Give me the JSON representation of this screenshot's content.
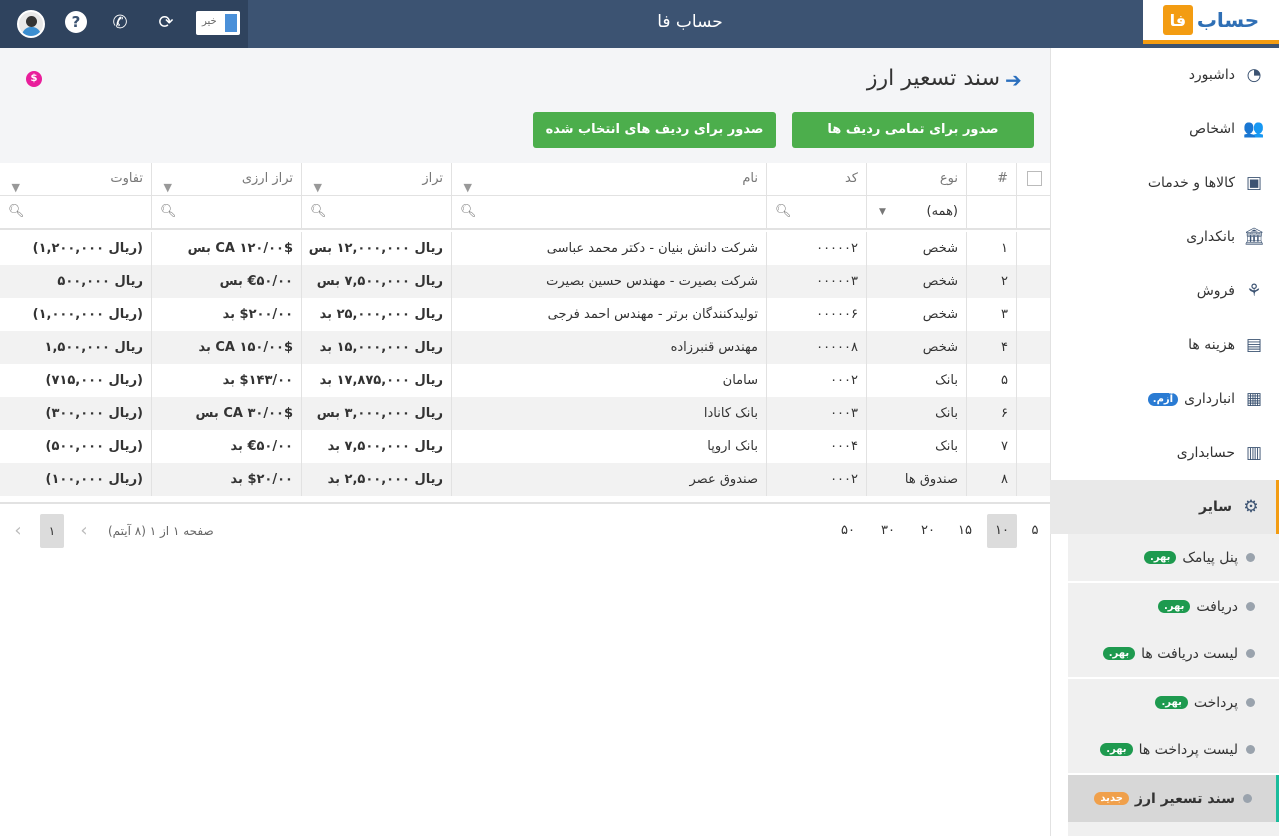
{
  "header": {
    "app_title": "حساب فا",
    "logo_text": "حساب",
    "logo_mark": "فا",
    "toggle_label": "خیر",
    "icons": [
      "user-avatar",
      "help-icon",
      "phone-icon",
      "refresh-icon",
      "toggle-switch"
    ]
  },
  "sidebar": {
    "items": [
      {
        "label": "داشبورد",
        "icon": "dashboard-icon"
      },
      {
        "label": "اشخاص",
        "icon": "people-icon"
      },
      {
        "label": "کالاها و خدمات",
        "icon": "box-icon"
      },
      {
        "label": "بانکداری",
        "icon": "bank-icon"
      },
      {
        "label": "فروش",
        "icon": "sales-icon"
      },
      {
        "label": "هزینه ها",
        "icon": "wallet-icon"
      },
      {
        "label": "انبارداری",
        "icon": "warehouse-icon",
        "badge": "آزم."
      },
      {
        "label": "حسابداری",
        "icon": "accounting-icon"
      },
      {
        "label": "سایر",
        "icon": "other-icon"
      }
    ],
    "sub_items": [
      {
        "label": "پنل پیامک",
        "badge": "بهر."
      },
      {
        "label": "دریافت",
        "badge": "بهر."
      },
      {
        "label": "لیست دریافت ها",
        "badge": "بهر."
      },
      {
        "label": "پرداخت",
        "badge": "بهر."
      },
      {
        "label": "لیست پرداخت ها",
        "badge": "بهر."
      },
      {
        "label": "سند تسعیر ارز",
        "badge": "جدید"
      }
    ]
  },
  "page": {
    "title": "سند تسعیر ارز",
    "btn_all": "صدور برای تمامی ردیف ها",
    "btn_selected": "صدور برای ردیف های انتخاب شده"
  },
  "grid": {
    "columns": [
      "#",
      "نوع",
      "کد",
      "نام",
      "تراز",
      "تراز ارزی",
      "تفاوت"
    ],
    "type_filter": "(همه)",
    "rows": [
      {
        "n": "۱",
        "type": "شخص",
        "code": "۰۰۰۰۰۲",
        "name": "شرکت دانش بنیان - دکتر محمد عباسی",
        "bal": "ریال ۱۲,۰۰۰,۰۰۰ بس",
        "fx": "$CA ۱۲۰/۰۰ بس",
        "diff": "(ریال ۱,۲۰۰,۰۰۰)",
        "bal_c": "blue",
        "fx_c": "blue",
        "diff_c": "red"
      },
      {
        "n": "۲",
        "type": "شخص",
        "code": "۰۰۰۰۰۳",
        "name": "شرکت بصیرت - مهندس حسین بصیرت",
        "bal": "ریال ۷,۵۰۰,۰۰۰ بس",
        "fx": "€۵۰/۰۰ بس",
        "diff": "ریال ۵۰۰,۰۰۰",
        "bal_c": "blue",
        "fx_c": "blue",
        "diff_c": "green"
      },
      {
        "n": "۳",
        "type": "شخص",
        "code": "۰۰۰۰۰۶",
        "name": "تولیدکنندگان برتر - مهندس احمد فرجی",
        "bal": "ریال ۲۵,۰۰۰,۰۰۰ بد",
        "fx": "$۲۰۰/۰۰ بد",
        "diff": "(ریال ۱,۰۰۰,۰۰۰)",
        "bal_c": "green",
        "fx_c": "green",
        "diff_c": "red"
      },
      {
        "n": "۴",
        "type": "شخص",
        "code": "۰۰۰۰۰۸",
        "name": "مهندس قنبرزاده",
        "bal": "ریال ۱۵,۰۰۰,۰۰۰ بد",
        "fx": "$CA ۱۵۰/۰۰ بد",
        "diff": "ریال ۱,۵۰۰,۰۰۰",
        "bal_c": "green",
        "fx_c": "green",
        "diff_c": "green"
      },
      {
        "n": "۵",
        "type": "بانک",
        "code": "۰۰۰۲",
        "name": "سامان",
        "bal": "ریال ۱۷,۸۷۵,۰۰۰ بد",
        "fx": "$۱۴۳/۰۰ بد",
        "diff": "(ریال ۷۱۵,۰۰۰)",
        "bal_c": "green",
        "fx_c": "green",
        "diff_c": "red"
      },
      {
        "n": "۶",
        "type": "بانک",
        "code": "۰۰۰۳",
        "name": "بانک کانادا",
        "bal": "ریال ۳,۰۰۰,۰۰۰ بس",
        "fx": "$CA ۳۰/۰۰ بس",
        "diff": "(ریال ۳۰۰,۰۰۰)",
        "bal_c": "blue",
        "fx_c": "blue",
        "diff_c": "red"
      },
      {
        "n": "۷",
        "type": "بانک",
        "code": "۰۰۰۴",
        "name": "بانک اروپا",
        "bal": "ریال ۷,۵۰۰,۰۰۰ بد",
        "fx": "€۵۰/۰۰ بد",
        "diff": "(ریال ۵۰۰,۰۰۰)",
        "bal_c": "green",
        "fx_c": "green",
        "diff_c": "red"
      },
      {
        "n": "۸",
        "type": "صندوق ها",
        "code": "۰۰۰۲",
        "name": "صندوق عصر",
        "bal": "ریال ۲,۵۰۰,۰۰۰ بد",
        "fx": "$۲۰/۰۰ بد",
        "diff": "(ریال ۱۰۰,۰۰۰)",
        "bal_c": "green",
        "fx_c": "green",
        "diff_c": "red"
      }
    ]
  },
  "pager": {
    "sizes": [
      "۵",
      "۱۰",
      "۱۵",
      "۲۰",
      "۳۰",
      "۵۰"
    ],
    "selected_size": "۱۰",
    "info": "صفحه ۱ از ۱ (۸ آیتم)",
    "current_page": "۱"
  },
  "colors": {
    "topbar": "#3c5372",
    "accent_orange": "#f39c12",
    "button_green": "#4cae4c",
    "value_blue": "#2a6ebd",
    "value_green": "#1e9a4f",
    "value_red": "#e04040"
  }
}
